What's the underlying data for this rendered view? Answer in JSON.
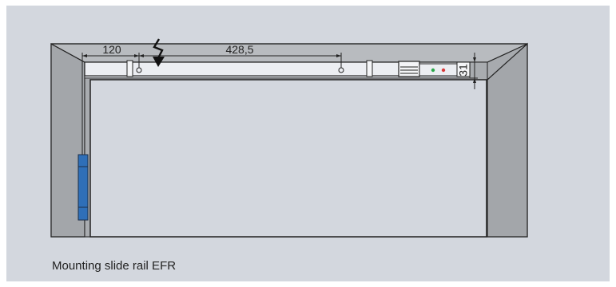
{
  "caption": "Mounting slide rail EFR",
  "dimensions": {
    "left_offset": "120",
    "span": "428,5",
    "height": "31"
  },
  "icons": {
    "power": "lightning-bolt-icon",
    "led_green": "led-green-icon",
    "led_red": "led-red-icon"
  },
  "colors": {
    "background": "#d3d7de",
    "frame": "#a7aaae",
    "rail": "#eceef2",
    "hinge": "#2f6fb8",
    "led_green": "#2aa84a",
    "led_red": "#d93a3a"
  }
}
